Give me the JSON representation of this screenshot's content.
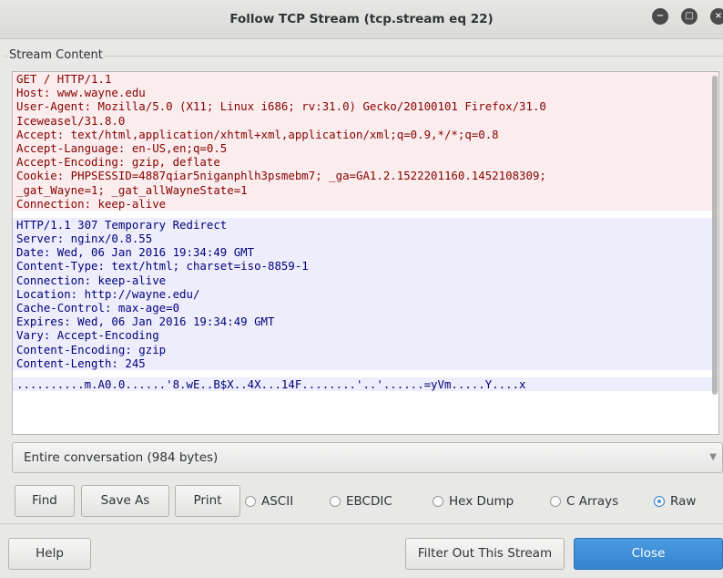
{
  "window": {
    "title": "Follow TCP Stream (tcp.stream eq 22)",
    "controls": {
      "minimize": "−",
      "maximize": "□",
      "close": "×"
    }
  },
  "stream": {
    "frame_label": "Stream Content",
    "client_lines": [
      "GET / HTTP/1.1",
      "Host: www.wayne.edu",
      "User-Agent: Mozilla/5.0 (X11; Linux i686; rv:31.0) Gecko/20100101 Firefox/31.0",
      "Iceweasel/31.8.0",
      "Accept: text/html,application/xhtml+xml,application/xml;q=0.9,*/*;q=0.8",
      "Accept-Language: en-US,en;q=0.5",
      "Accept-Encoding: gzip, deflate",
      "Cookie: PHPSESSID=4887qiar5niganphlh3psmebm7; _ga=GA1.2.1522201160.1452108309;",
      "_gat_Wayne=1; _gat_allWayneState=1",
      "Connection: keep-alive"
    ],
    "server_lines": [
      "HTTP/1.1 307 Temporary Redirect",
      "Server: nginx/0.8.55",
      "Date: Wed, 06 Jan 2016 19:34:49 GMT",
      "Content-Type: text/html; charset=iso-8859-1",
      "Connection: keep-alive",
      "Location: http://wayne.edu/",
      "Cache-Control: max-age=0",
      "Expires: Wed, 06 Jan 2016 19:34:49 GMT",
      "Vary: Accept-Encoding",
      "Content-Encoding: gzip",
      "Content-Length: 245"
    ],
    "binary_line": "..........m.A0.0......'8.wE..B$X..4X...14F........'..'......=yVm.....Y....x"
  },
  "conversation_select": {
    "value": "Entire conversation (984 bytes)"
  },
  "buttons": {
    "find": "Find",
    "save_as": "Save As",
    "print": "Print",
    "help": "Help",
    "filter_out": "Filter Out This Stream",
    "close": "Close"
  },
  "format_options": [
    {
      "label": "ASCII",
      "selected": false
    },
    {
      "label": "EBCDIC",
      "selected": false
    },
    {
      "label": "Hex Dump",
      "selected": false
    },
    {
      "label": "C Arrays",
      "selected": false
    },
    {
      "label": "Raw",
      "selected": true
    }
  ],
  "colors": {
    "client_text": "#870000",
    "client_bg": "#fbeded",
    "server_text": "#00007c",
    "server_bg": "#ededfb",
    "accent": "#4a90d9"
  }
}
